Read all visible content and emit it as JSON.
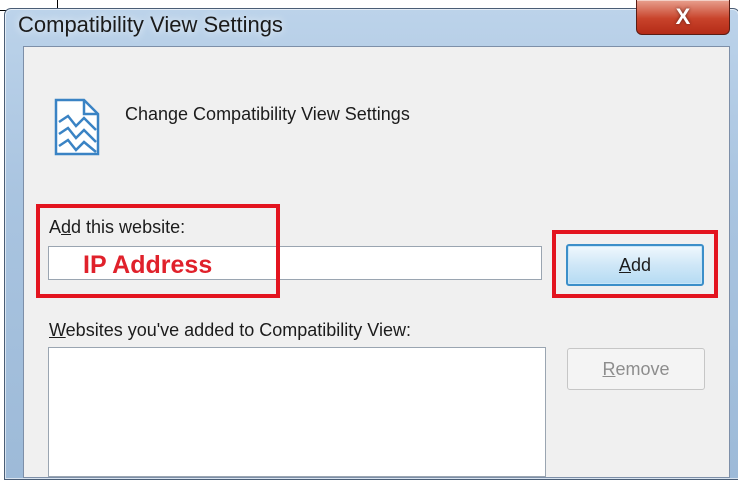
{
  "window": {
    "title": "Compatibility View Settings",
    "close_label": "X"
  },
  "header": {
    "heading": "Change Compatibility View Settings",
    "icon": "document-icon"
  },
  "add_section": {
    "label_prefix": "A",
    "label_accel": "d",
    "label_suffix": "d this website:",
    "input_value": "IP Address",
    "add_button_accel": "A",
    "add_button_rest": "dd"
  },
  "list_section": {
    "label_accel": "W",
    "label_rest": "ebsites you've added to Compatibility View:",
    "items": [],
    "remove_button_accel": "R",
    "remove_button_rest": "emove"
  },
  "colors": {
    "highlight": "#e3141f",
    "input_text": "#e0212b",
    "add_button_border": "#3c8fc9"
  }
}
